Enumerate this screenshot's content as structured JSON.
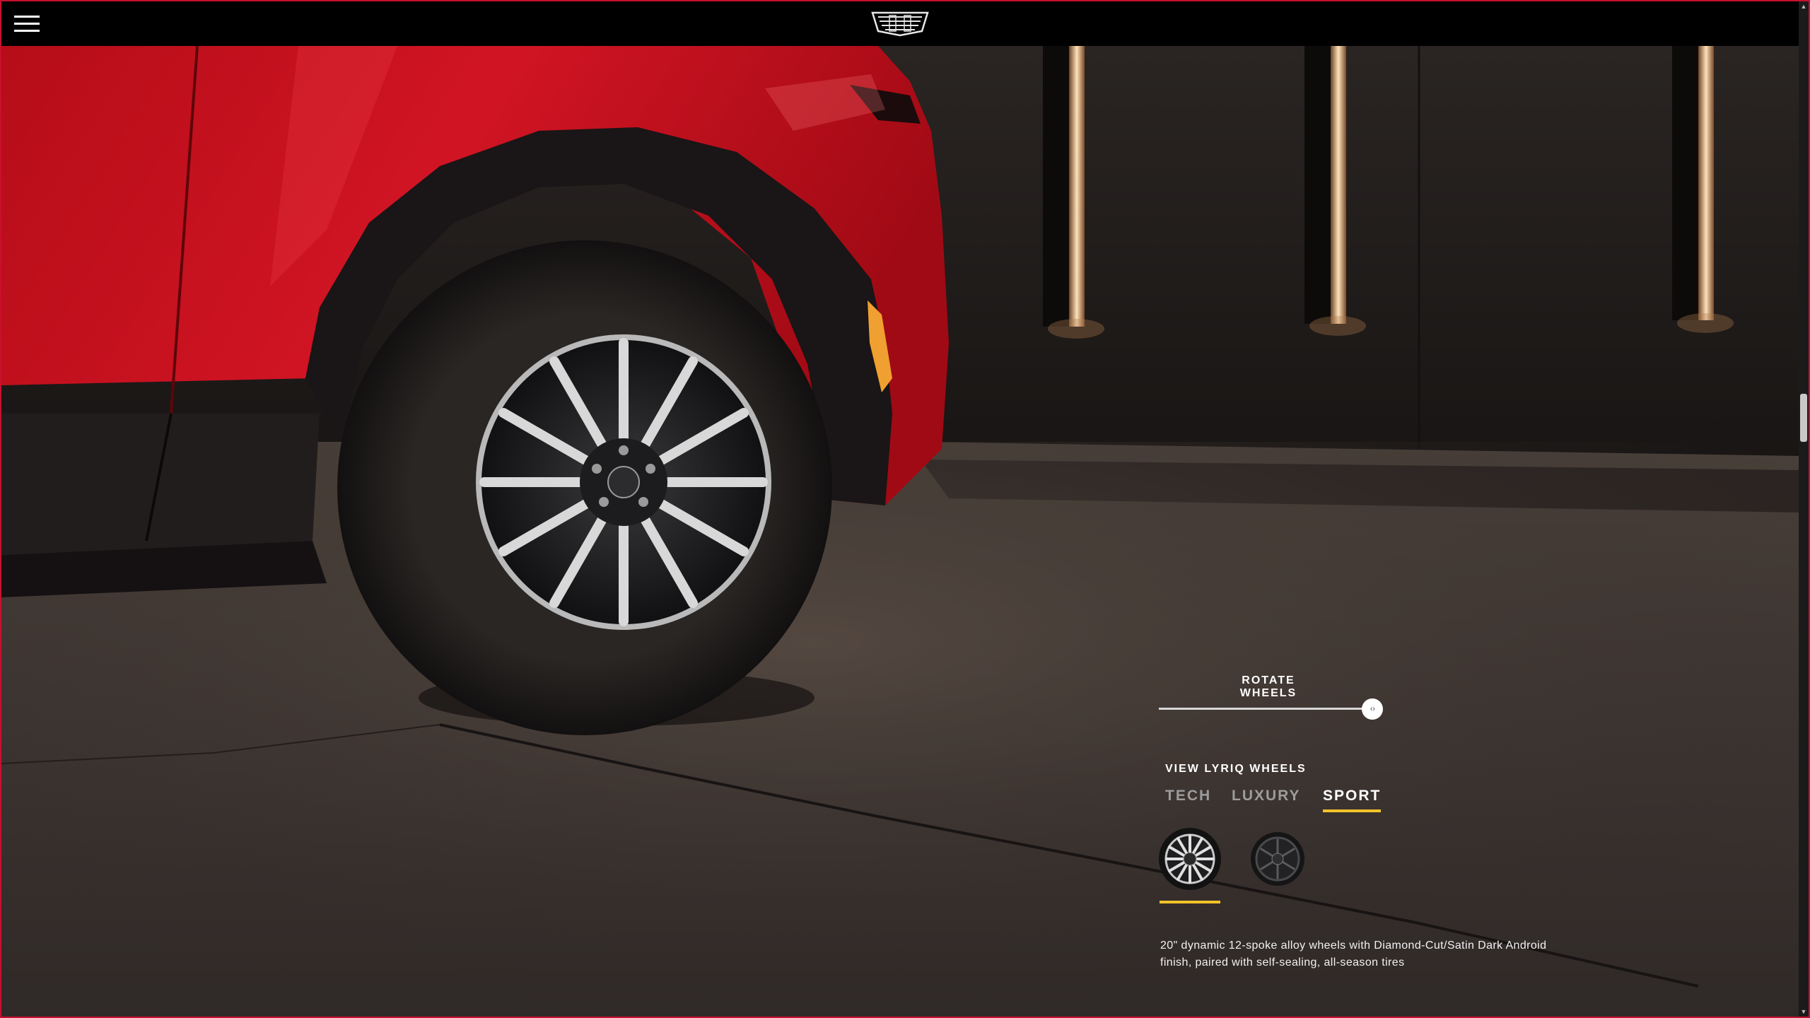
{
  "header": {
    "menu_icon": "hamburger-menu-icon",
    "logo_icon": "cadillac-crest-logo"
  },
  "rotator": {
    "title": "ROTATE WHEELS",
    "slider_value": 0.96,
    "thumb_glyph": "‹›"
  },
  "wheels": {
    "title": "VIEW LYRIQ WHEELS",
    "tabs": [
      {
        "label": "TECH",
        "active": false
      },
      {
        "label": "LUXURY",
        "active": false
      },
      {
        "label": "SPORT",
        "active": true
      }
    ],
    "swatches": [
      {
        "name": "12-spoke diamond-cut wheel",
        "selected": true
      },
      {
        "name": "dark wheel",
        "selected": false
      }
    ],
    "description": "20\" dynamic 12-spoke alloy wheels with Diamond-Cut/Satin Dark Android finish, paired with self-sealing, all-season tires"
  },
  "colors": {
    "accent": "#f2c32a",
    "car_red": "#c8101e",
    "frame_border": "#c8102e"
  }
}
